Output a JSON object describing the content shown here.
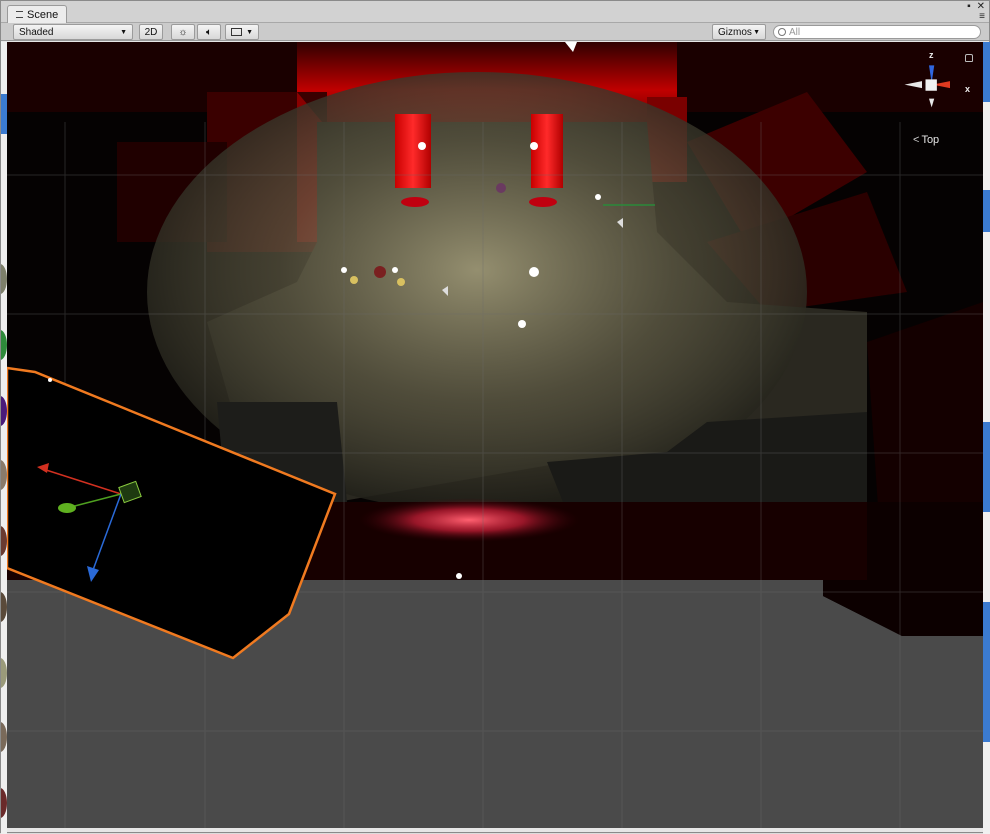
{
  "tab": {
    "label": "Scene",
    "icon": "scene-icon"
  },
  "window_controls": {
    "menu": "▪",
    "close": "✕",
    "options": "≡"
  },
  "toolbar": {
    "shading_mode": "Shaded",
    "mode_2d": "2D",
    "gizmos_label": "Gizmos",
    "search_placeholder": "All"
  },
  "gizmo": {
    "view_label": "Top",
    "axis_z": "z",
    "axis_x": "x"
  },
  "colors": {
    "accent_red": "#d01010",
    "selection_orange": "#f07a20",
    "floor_gray": "#4a4a4a",
    "viewport_bg": "#020101"
  },
  "icons": [
    "scene-icon",
    "sun-icon",
    "audio-icon",
    "image-effects-icon",
    "search-icon",
    "lock-icon",
    "light-bulb-icon",
    "audio-source-icon",
    "move-gizmo-icon"
  ]
}
